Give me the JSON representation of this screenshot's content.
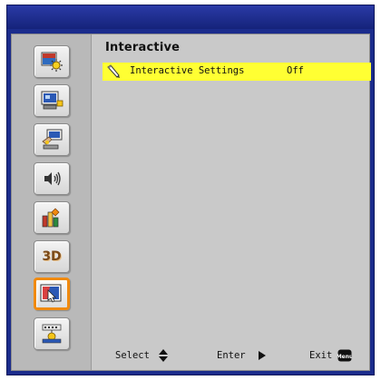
{
  "menu": {
    "title": "Interactive",
    "items": [
      {
        "label": "Interactive Settings",
        "value": "Off",
        "icon": "pen-icon",
        "selected": true
      }
    ]
  },
  "sidebar": {
    "items": [
      {
        "name": "picture",
        "icon": "picture-icon"
      },
      {
        "name": "display",
        "icon": "display-icon"
      },
      {
        "name": "setup",
        "icon": "setup-icon"
      },
      {
        "name": "volume",
        "icon": "speaker-icon"
      },
      {
        "name": "options",
        "icon": "options-icon"
      },
      {
        "name": "3d",
        "icon": "3d-icon",
        "label": "3D"
      },
      {
        "name": "interactive",
        "icon": "interactive-icon",
        "active": true
      },
      {
        "name": "lan",
        "icon": "network-icon"
      }
    ]
  },
  "footer": {
    "select_label": "Select",
    "enter_label": "Enter",
    "exit_label": "Exit",
    "menu_key_label": "Menu"
  },
  "colors": {
    "frame": "#1b2c8c",
    "panel": "#c9c9c9",
    "highlight": "#ffff33",
    "active_border": "#f08a10"
  }
}
